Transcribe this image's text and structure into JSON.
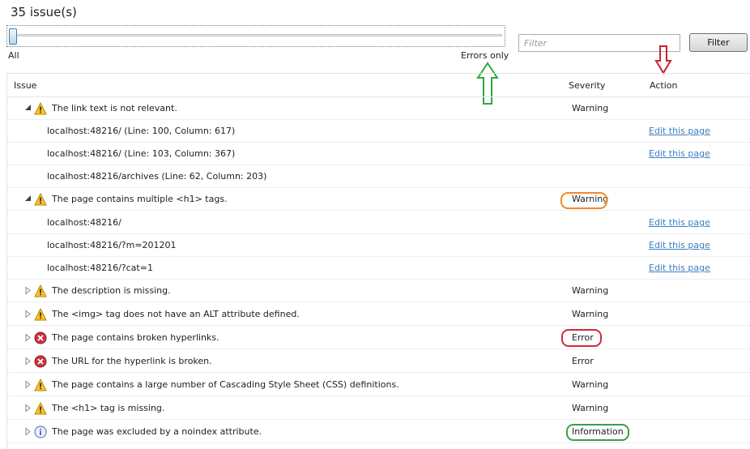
{
  "header": {
    "issue_count": "35 issue(s)",
    "slider": {
      "min_label": "All",
      "max_label": "Errors only",
      "level": 0
    },
    "filter": {
      "placeholder": "Filter",
      "value": "",
      "button_label": "Filter"
    }
  },
  "table": {
    "columns": {
      "issue": "Issue",
      "severity": "Severity",
      "action": "Action"
    },
    "rows": [
      {
        "issue": "The link text is not relevant.",
        "severity": "Warning",
        "action": ""
      },
      {
        "issue": "localhost:48216/   (Line: 100, Column: 617)",
        "severity": "",
        "action": "Edit this page"
      },
      {
        "issue": "localhost:48216/   (Line: 103, Column: 367)",
        "severity": "",
        "action": "Edit this page"
      },
      {
        "issue": "localhost:48216/archives   (Line: 62, Column: 203)",
        "severity": "",
        "action": ""
      },
      {
        "issue": "The page contains multiple <h1> tags.",
        "severity": "Warning",
        "action": ""
      },
      {
        "issue": "localhost:48216/",
        "severity": "",
        "action": "Edit this page"
      },
      {
        "issue": "localhost:48216/?m=201201",
        "severity": "",
        "action": "Edit this page"
      },
      {
        "issue": "localhost:48216/?cat=1",
        "severity": "",
        "action": "Edit this page"
      },
      {
        "issue": "The description is missing.",
        "severity": "Warning",
        "action": ""
      },
      {
        "issue": "The <img> tag does not have an ALT attribute defined.",
        "severity": "Warning",
        "action": ""
      },
      {
        "issue": "The page contains broken hyperlinks.",
        "severity": "Error",
        "action": ""
      },
      {
        "issue": "The URL for the hyperlink is broken.",
        "severity": "Error",
        "action": ""
      },
      {
        "issue": "The page contains  a large number of Cascading Style Sheet (CSS) definitions.",
        "severity": "Warning",
        "action": ""
      },
      {
        "issue": "The <h1> tag is missing.",
        "severity": "Warning",
        "action": ""
      },
      {
        "issue": "The page was excluded by a noindex attribute.",
        "severity": "Information",
        "action": ""
      }
    ]
  },
  "icons": {
    "expanded": "triangle-down-icon",
    "collapsed": "triangle-right-icon",
    "Warning": "warning-icon",
    "Error": "error-icon",
    "Information": "information-icon"
  },
  "colors": {
    "link": "#3b7fc1",
    "annotation_orange": "#ef8a2a",
    "annotation_red": "#cf2b3b",
    "annotation_green": "#36a24a",
    "arrow_green": "#2fa640",
    "arrow_red": "#d2202f"
  }
}
